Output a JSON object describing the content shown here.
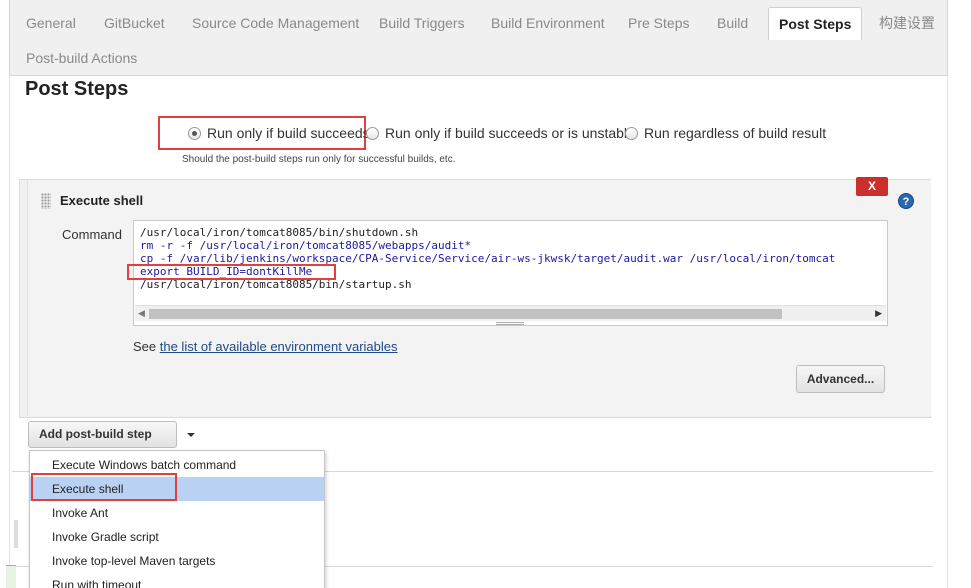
{
  "tabs": [
    {
      "label": "General"
    },
    {
      "label": "GitBucket"
    },
    {
      "label": "Source Code Management"
    },
    {
      "label": "Build Triggers"
    },
    {
      "label": "Build Environment"
    },
    {
      "label": "Pre Steps"
    },
    {
      "label": "Build"
    },
    {
      "label": "Post Steps"
    },
    {
      "label": "构建设置"
    },
    {
      "label": "Post-build Actions"
    }
  ],
  "active_tab": "Post Steps",
  "page_title": "Post Steps",
  "run_options": {
    "options": [
      {
        "label": "Run only if build succeeds",
        "checked": true
      },
      {
        "label": "Run only if build succeeds or is unstable",
        "checked": false
      },
      {
        "label": "Run regardless of build result",
        "checked": false
      }
    ],
    "hint": "Should the post-build steps run only for successful builds, etc."
  },
  "execute_shell": {
    "title": "Execute shell",
    "close_label": "X",
    "help_label": "?",
    "command_label": "Command",
    "command_lines": [
      "/usr/local/iron/tomcat8085/bin/shutdown.sh",
      "rm -r -f /usr/local/iron/tomcat8085/webapps/audit*",
      "cp -f /var/lib/jenkins/workspace/CPA-Service/Service/air-ws-jkwsk/target/audit.war /usr/local/iron/tomcat",
      "export BUILD_ID=dontKillMe",
      "/usr/local/iron/tomcat8085/bin/startup.sh"
    ],
    "see_prefix": "See ",
    "see_link": "the list of available environment variables",
    "advanced_label": "Advanced..."
  },
  "add_step_label": "Add post-build step",
  "menu": {
    "items": [
      {
        "label": "Execute Windows batch command",
        "selected": false
      },
      {
        "label": "Execute shell",
        "selected": true
      },
      {
        "label": "Invoke Ant",
        "selected": false
      },
      {
        "label": "Invoke Gradle script",
        "selected": false
      },
      {
        "label": "Invoke top-level Maven targets",
        "selected": false
      },
      {
        "label": "Run with timeout",
        "selected": false
      }
    ]
  },
  "colors": {
    "highlight": "#e04040",
    "close_button": "#c9302c",
    "link": "#204a87",
    "menu_selected": "#b9d1f2"
  }
}
